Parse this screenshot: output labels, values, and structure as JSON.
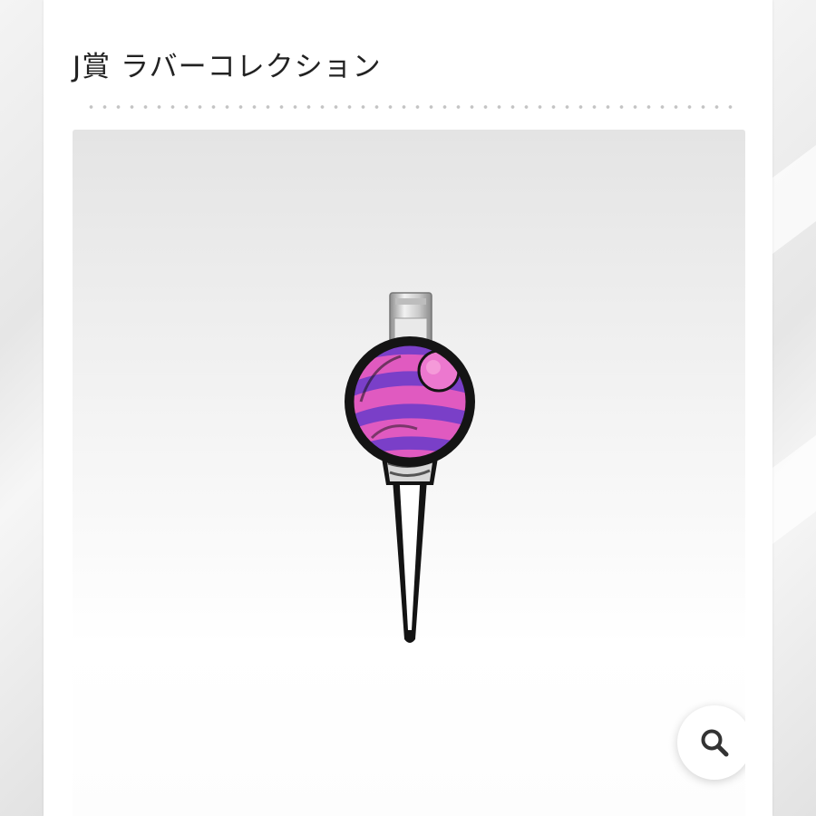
{
  "product": {
    "title": "J賞 ラバーコレクション",
    "image": {
      "subject": "lollipop-rubber-clip",
      "colors": {
        "pink": "#e05ac0",
        "purple": "#7a3fc8",
        "outline": "#141414"
      }
    },
    "zoom_button": {
      "icon": "search-icon"
    }
  }
}
